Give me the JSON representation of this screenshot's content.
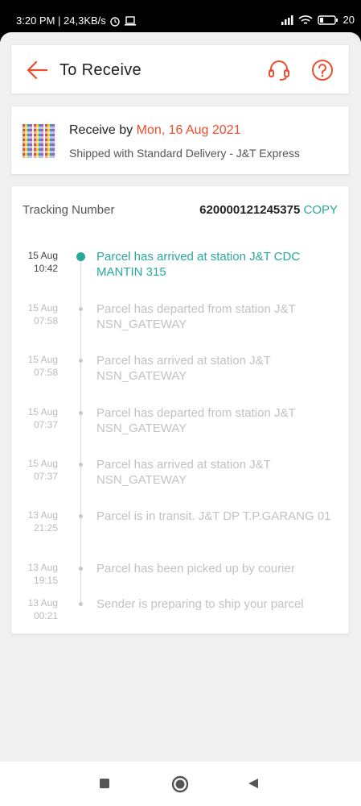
{
  "status_bar": {
    "time_speed": "3:20 PM | 24,3KB/s",
    "battery": "20"
  },
  "header": {
    "title": "To Receive"
  },
  "delivery": {
    "receive_prefix": "Receive by",
    "receive_date": "Mon, 16 Aug 2021",
    "shipped_text": "Shipped with Standard Delivery  - J&T Express"
  },
  "tracking": {
    "label": "Tracking Number",
    "number": "620000121245375",
    "copy_label": "COPY",
    "events": [
      {
        "date": "15 Aug",
        "time": "10:42",
        "text": "Parcel has arrived at station J&T CDC MANTIN 315",
        "active": true
      },
      {
        "date": "15 Aug",
        "time": "07:58",
        "text": "Parcel has departed from station J&T NSN_GATEWAY",
        "active": false
      },
      {
        "date": "15 Aug",
        "time": "07:58",
        "text": "Parcel has arrived at station J&T NSN_GATEWAY",
        "active": false
      },
      {
        "date": "15 Aug",
        "time": "07:37",
        "text": "Parcel has departed from station J&T NSN_GATEWAY",
        "active": false
      },
      {
        "date": "15 Aug",
        "time": "07:37",
        "text": "Parcel has arrived at station J&T NSN_GATEWAY",
        "active": false
      },
      {
        "date": "13 Aug",
        "time": "21:25",
        "text": "Parcel is in transit. J&T DP T.P.GARANG 01",
        "active": false
      },
      {
        "date": "13 Aug",
        "time": "19:15",
        "text": "Parcel has been picked up by courier",
        "active": false
      },
      {
        "date": "13 Aug",
        "time": "00:21",
        "text": "Sender is preparing to ship your parcel",
        "active": false
      }
    ]
  },
  "colors": {
    "accent": "#ee4d2d",
    "teal": "#26aa99"
  },
  "icons": {
    "back": "arrow-left-icon",
    "support": "headset-icon",
    "help": "question-circle-icon"
  }
}
